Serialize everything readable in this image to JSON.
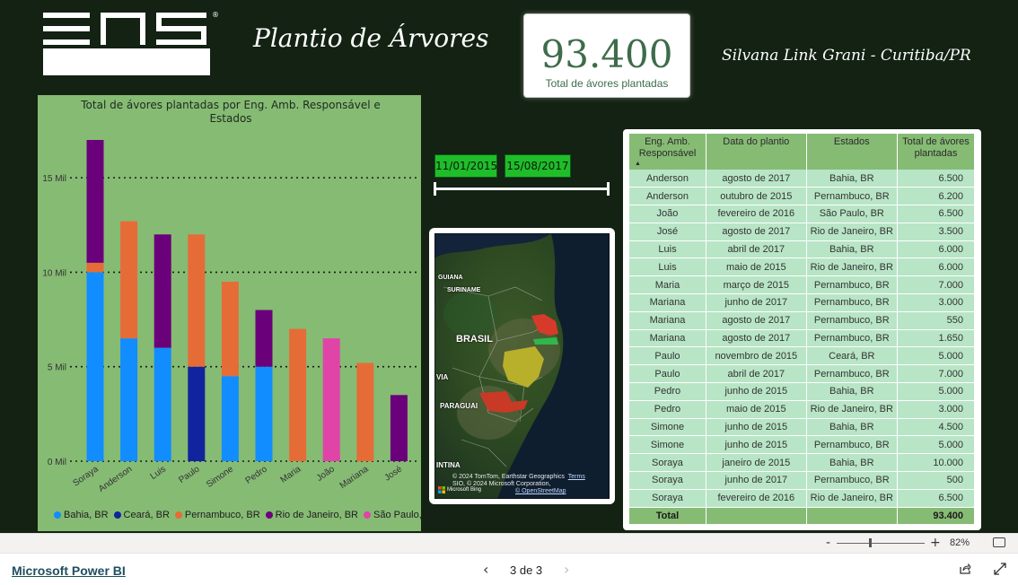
{
  "header": {
    "title": "Plantio de Árvores",
    "author": "Silvana Link Grani - Curitiba/PR",
    "logo_reg": "®"
  },
  "kpi": {
    "value": "93.400",
    "label": "Total de ávores plantadas"
  },
  "date_slicer": {
    "start": "11/01/2015",
    "end": "15/08/2017"
  },
  "map": {
    "labels": [
      "GUIANA",
      "SURINAME",
      "BRASIL",
      "PARAGUAI",
      "INTINA",
      "VIA"
    ],
    "credit_line1": "© 2024 TomTom, Earthstar Geographics",
    "credit_terms": "Terms",
    "credit_line2": "SIO, © 2024 Microsoft Corporation,",
    "credit_line3": "© OpenStreetMap",
    "bing": "Microsoft Bing"
  },
  "colors": {
    "Bahia, BR": "#118dff",
    "Ceará, BR": "#12239e",
    "Pernambuco, BR": "#e66c37",
    "Rio de Janeiro, BR": "#6b007b",
    "São Paulo, BR": "#e044a7"
  },
  "chart_data": {
    "type": "bar",
    "stacked": true,
    "title": "Total de ávores plantadas por Eng. Amb. Responsável e Estados",
    "categories": [
      "Soraya",
      "Anderson",
      "Luis",
      "Paulo",
      "Simone",
      "Pedro",
      "Maria",
      "João",
      "Mariana",
      "José"
    ],
    "series": [
      {
        "name": "Bahia, BR",
        "values": [
          10000,
          6500,
          6000,
          0,
          4500,
          5000,
          0,
          0,
          0,
          0
        ]
      },
      {
        "name": "Ceará, BR",
        "values": [
          0,
          0,
          0,
          5000,
          0,
          0,
          0,
          0,
          0,
          0
        ]
      },
      {
        "name": "Pernambuco, BR",
        "values": [
          500,
          6200,
          0,
          7000,
          5000,
          0,
          7000,
          0,
          5200,
          0
        ]
      },
      {
        "name": "Rio de Janeiro, BR",
        "values": [
          6500,
          0,
          6000,
          0,
          0,
          3000,
          0,
          0,
          0,
          3500
        ]
      },
      {
        "name": "São Paulo, BR",
        "values": [
          0,
          0,
          0,
          0,
          0,
          0,
          0,
          6500,
          0,
          0
        ]
      }
    ],
    "yticks": [
      "0 Mil",
      "5 Mil",
      "10 Mil",
      "15 Mil"
    ],
    "ytick_values": [
      0,
      5000,
      10000,
      15000
    ],
    "ylim": [
      0,
      17000
    ],
    "legend_position": "bottom",
    "grid": true
  },
  "table": {
    "columns": [
      "Eng. Amb. Responsável",
      "Data do plantio",
      "Estados",
      "Total de ávores plantadas"
    ],
    "rows": [
      [
        "Anderson",
        "agosto de 2017",
        "Bahia, BR",
        "6.500"
      ],
      [
        "Anderson",
        "outubro de 2015",
        "Pernambuco, BR",
        "6.200"
      ],
      [
        "João",
        "fevereiro de 2016",
        "São Paulo, BR",
        "6.500"
      ],
      [
        "José",
        "agosto de 2017",
        "Rio de Janeiro, BR",
        "3.500"
      ],
      [
        "Luis",
        "abril de 2017",
        "Bahia, BR",
        "6.000"
      ],
      [
        "Luis",
        "maio de 2015",
        "Rio de Janeiro, BR",
        "6.000"
      ],
      [
        "Maria",
        "março de 2015",
        "Pernambuco, BR",
        "7.000"
      ],
      [
        "Mariana",
        "junho de 2017",
        "Pernambuco, BR",
        "3.000"
      ],
      [
        "Mariana",
        "agosto de 2017",
        "Pernambuco, BR",
        "550"
      ],
      [
        "Mariana",
        "agosto de 2017",
        "Pernambuco, BR",
        "1.650"
      ],
      [
        "Paulo",
        "novembro de 2015",
        "Ceará, BR",
        "5.000"
      ],
      [
        "Paulo",
        "abril de 2017",
        "Pernambuco, BR",
        "7.000"
      ],
      [
        "Pedro",
        "junho de 2015",
        "Bahia, BR",
        "5.000"
      ],
      [
        "Pedro",
        "maio de 2015",
        "Rio de Janeiro, BR",
        "3.000"
      ],
      [
        "Simone",
        "junho de 2015",
        "Bahia, BR",
        "4.500"
      ],
      [
        "Simone",
        "junho de 2015",
        "Pernambuco, BR",
        "5.000"
      ],
      [
        "Soraya",
        "janeiro de 2015",
        "Bahia, BR",
        "10.000"
      ],
      [
        "Soraya",
        "junho de 2017",
        "Pernambuco, BR",
        "500"
      ],
      [
        "Soraya",
        "fevereiro de 2016",
        "Rio de Janeiro, BR",
        "6.500"
      ]
    ],
    "total_label": "Total",
    "total_value": "93.400"
  },
  "zoom": {
    "minus": "-",
    "plus": "+",
    "percent": "82%"
  },
  "footer": {
    "brand_link": "Microsoft Power BI",
    "pager": "3 de 3",
    "prev": "‹",
    "next": "›"
  }
}
